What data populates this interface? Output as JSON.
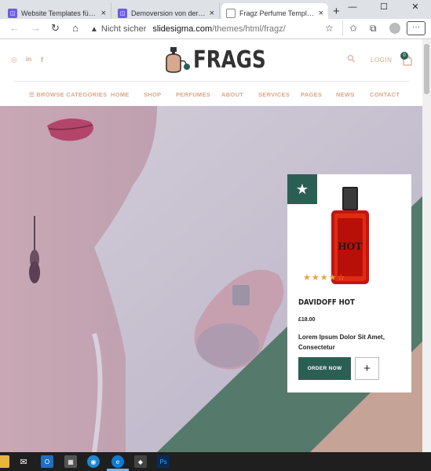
{
  "browser": {
    "tabs": [
      {
        "title": "Website Templates für Mode…",
        "active": false
      },
      {
        "title": "Demoversion von der Website",
        "active": false
      },
      {
        "title": "Fragz Perfume Template | Ho…",
        "active": true
      }
    ],
    "new_tab": "+",
    "close_glyph": "×",
    "window_controls": {
      "minimize": "—",
      "maximize": "☐",
      "close": "✕"
    },
    "address": {
      "security_label": "Nicht sicher",
      "domain": "slidesigma.com",
      "path": "/themes/html/fragz/"
    },
    "nav": {
      "back": "←",
      "forward": "→",
      "reload": "↻",
      "home": "⌂"
    },
    "toolbar_icons": {
      "add_favorite": "☆",
      "favorites": "✩",
      "collections": "⧉",
      "menu": "···"
    }
  },
  "site": {
    "logo": "FRAGS",
    "social_icons": [
      "instagram-icon",
      "linkedin-icon",
      "facebook-icon"
    ],
    "social_glyphs": {
      "instagram": "◎",
      "linkedin": "in",
      "facebook": "f"
    },
    "search_glyph": "⚲",
    "login_label": "LOGIN",
    "cart_count": "0",
    "menu": {
      "browse_label": "BROWSE CATEGORIES",
      "browse_glyph": "☰",
      "items": [
        "HOME",
        "SHOP",
        "PERFUMES",
        "ABOUT",
        "SERVICES",
        "PAGES",
        "NEWS",
        "CONTACT"
      ]
    },
    "product_card": {
      "star_glyph": "★",
      "rating_stars": "★★★★☆",
      "rating": 4.5,
      "bottle_label": "HOT",
      "name": "DAVIDOFF HOT",
      "price": "£18.00",
      "description": "Lorem Ipsum Dolor Sit Amet, Consectetur",
      "order_label": "ORDER NOW",
      "add_glyph": "+"
    }
  },
  "colors": {
    "accent_peach": "#d8a88d",
    "brand_green": "#2c5f54",
    "rating_gold": "#e8a33a"
  }
}
